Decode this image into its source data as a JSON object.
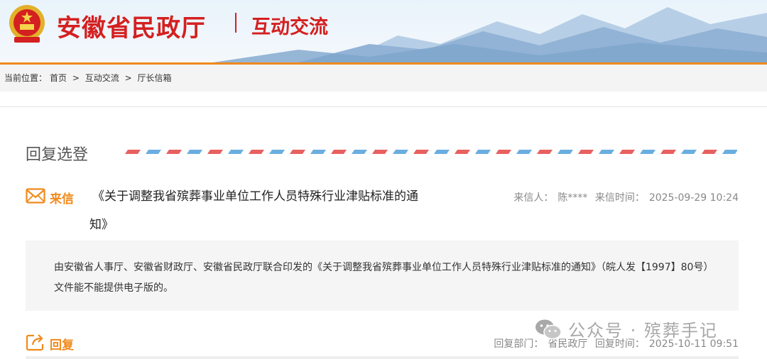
{
  "header": {
    "site_title": "安徽省民政厅",
    "section_title": "互动交流"
  },
  "breadcrumb": {
    "prefix": "当前位置：",
    "items": [
      "首页",
      "互动交流",
      "厅长信箱"
    ],
    "separator": ">"
  },
  "main": {
    "heading": "回复选登",
    "letter": {
      "label": "来信",
      "title": "《关于调整我省殡葬事业单位工作人员特殊行业津贴标准的通知》",
      "sender_label": "来信人：",
      "sender": "陈****",
      "time_label": "来信时间：",
      "time": "2025-09-29 10:24",
      "content": "由安徽省人事厅、安徽省财政厅、安徽省民政厅联合印发的《关于调整我省殡葬事业单位工作人员特殊行业津贴标准的通知》（皖人发【1997】80号）文件能不能提供电子版的。"
    },
    "reply": {
      "label": "回复",
      "dept_label": "回复部门：",
      "dept": "省民政厅",
      "time_label": "回复时间：",
      "time": "2025-10-11 09:51"
    }
  },
  "watermark": {
    "text": "公众号 · 殡葬手记"
  },
  "colors": {
    "brand_red": "#d42020",
    "accent_orange": "#f08a1c",
    "airmail_red": "#e86060",
    "airmail_blue": "#6aaee0"
  }
}
